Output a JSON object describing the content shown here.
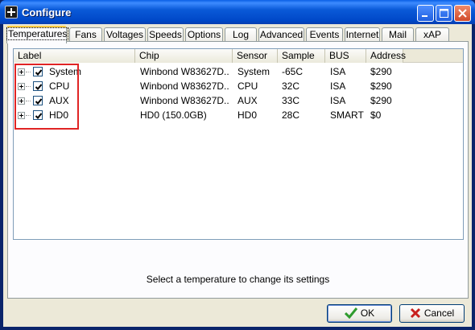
{
  "window": {
    "title": "Configure"
  },
  "tabs": [
    {
      "label": "Temperatures",
      "active": true
    },
    {
      "label": "Fans"
    },
    {
      "label": "Voltages"
    },
    {
      "label": "Speeds"
    },
    {
      "label": "Options"
    },
    {
      "label": "Log"
    },
    {
      "label": "Advanced"
    },
    {
      "label": "Events"
    },
    {
      "label": "Internet"
    },
    {
      "label": "Mail"
    },
    {
      "label": "xAP"
    }
  ],
  "table": {
    "columns": [
      "Label",
      "Chip",
      "Sensor",
      "Sample",
      "BUS",
      "Address"
    ],
    "rows": [
      {
        "label": "System",
        "chip": "Winbond W83627D...",
        "sensor": "System",
        "sample": "-65C",
        "bus": "ISA",
        "address": "$290",
        "checked": true
      },
      {
        "label": "CPU",
        "chip": "Winbond W83627D...",
        "sensor": "CPU",
        "sample": "32C",
        "bus": "ISA",
        "address": "$290",
        "checked": true
      },
      {
        "label": "AUX",
        "chip": "Winbond W83627D...",
        "sensor": "AUX",
        "sample": "33C",
        "bus": "ISA",
        "address": "$290",
        "checked": true
      },
      {
        "label": "HD0",
        "chip": "HD0 (150.0GB)",
        "sensor": "HD0",
        "sample": "28C",
        "bus": "SMART",
        "address": "$0",
        "checked": true
      }
    ]
  },
  "status": {
    "message": "Select a temperature to change its settings"
  },
  "buttons": {
    "ok": "OK",
    "cancel": "Cancel"
  },
  "colors": {
    "highlight": "#E02424",
    "titlebar": "#0A5AD8",
    "ok_icon": "#2E9B2E",
    "cancel_icon": "#C8201E"
  }
}
